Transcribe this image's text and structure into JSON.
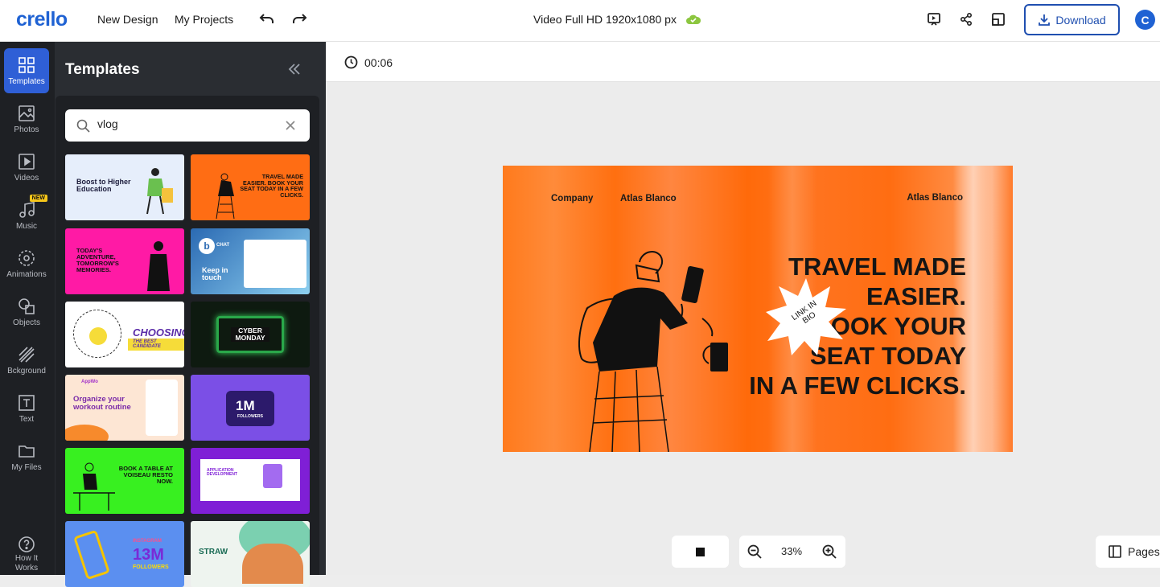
{
  "app": {
    "logo": "crello"
  },
  "header": {
    "new_design": "New Design",
    "my_projects": "My Projects",
    "doc_title": "Video Full HD 1920x1080 px",
    "download": "Download",
    "avatar_initial": "C"
  },
  "rail": {
    "items": [
      {
        "label": "Templates",
        "icon": "templates-icon"
      },
      {
        "label": "Photos",
        "icon": "photos-icon"
      },
      {
        "label": "Videos",
        "icon": "videos-icon"
      },
      {
        "label": "Music",
        "icon": "music-icon",
        "badge": "NEW"
      },
      {
        "label": "Animations",
        "icon": "animations-icon"
      },
      {
        "label": "Objects",
        "icon": "objects-icon"
      },
      {
        "label": "Bckground",
        "icon": "background-icon"
      },
      {
        "label": "Text",
        "icon": "text-icon"
      },
      {
        "label": "My Files",
        "icon": "folder-icon"
      }
    ],
    "help_line1": "How It",
    "help_line2": "Works"
  },
  "panel": {
    "title": "Templates",
    "search_value": "vlog"
  },
  "templates": [
    {
      "text": "Boost to Higher Education"
    },
    {
      "text": "TRAVEL MADE EASIER. BOOK YOUR SEAT TODAY IN A FEW CLICKS."
    },
    {
      "text": "TODAY'S ADVENTURE, TOMORROW'S MEMORIES."
    },
    {
      "text": "Keep in touch",
      "sub": "CHAT"
    },
    {
      "text": "CHOOSING",
      "sub": "THE BEST CANDIDATE"
    },
    {
      "text": "CYBER MONDAY"
    },
    {
      "text": "Organize your workout routine",
      "sub": "AppWo"
    },
    {
      "text": "1M",
      "sub": "FOLLOWERS"
    },
    {
      "text": "BOOK A TABLE AT VOISEAU RESTO NOW."
    },
    {
      "text": "APPLICATION DEVELOPMENT"
    },
    {
      "text": "13M",
      "sub": "FOLLOWERS",
      "top": "INSTAGRAM"
    },
    {
      "text": "STRAW"
    }
  ],
  "timeline": {
    "time": "00:06"
  },
  "artboard": {
    "company": "Company",
    "brand_left": "Atlas Blanco",
    "brand_right": "Atlas Blanco",
    "headline_lines": [
      "TRAVEL MADE",
      "EASIER.",
      "BOOK YOUR",
      "SEAT TODAY",
      "IN A FEW CLICKS."
    ],
    "sticker": "LINK IN BIO",
    "bg_color": "#ff6d12"
  },
  "controls": {
    "zoom": "33%",
    "pages": "Pages"
  }
}
